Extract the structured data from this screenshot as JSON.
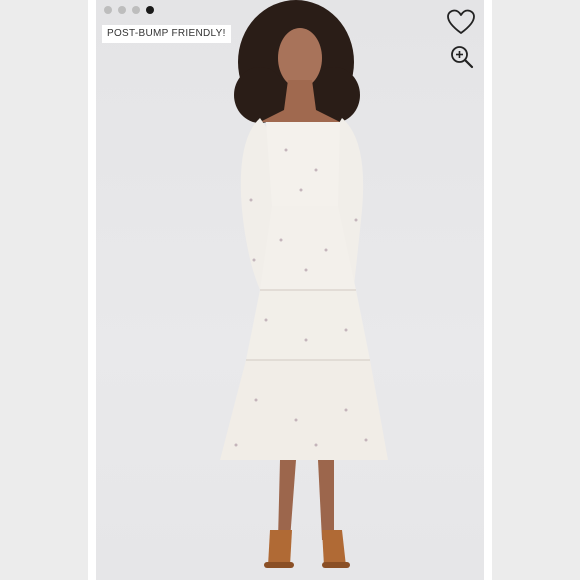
{
  "gallery": {
    "badge_label": "POST-BUMP FRIENDLY!",
    "dots": [
      {
        "active": false
      },
      {
        "active": false
      },
      {
        "active": false
      },
      {
        "active": true
      }
    ],
    "icons": {
      "favorite": "heart-icon",
      "zoom": "zoom-in-icon"
    }
  },
  "colors": {
    "background": "#e7e7e9",
    "dress": "#f3f0ec",
    "sandal": "#b06a35"
  }
}
